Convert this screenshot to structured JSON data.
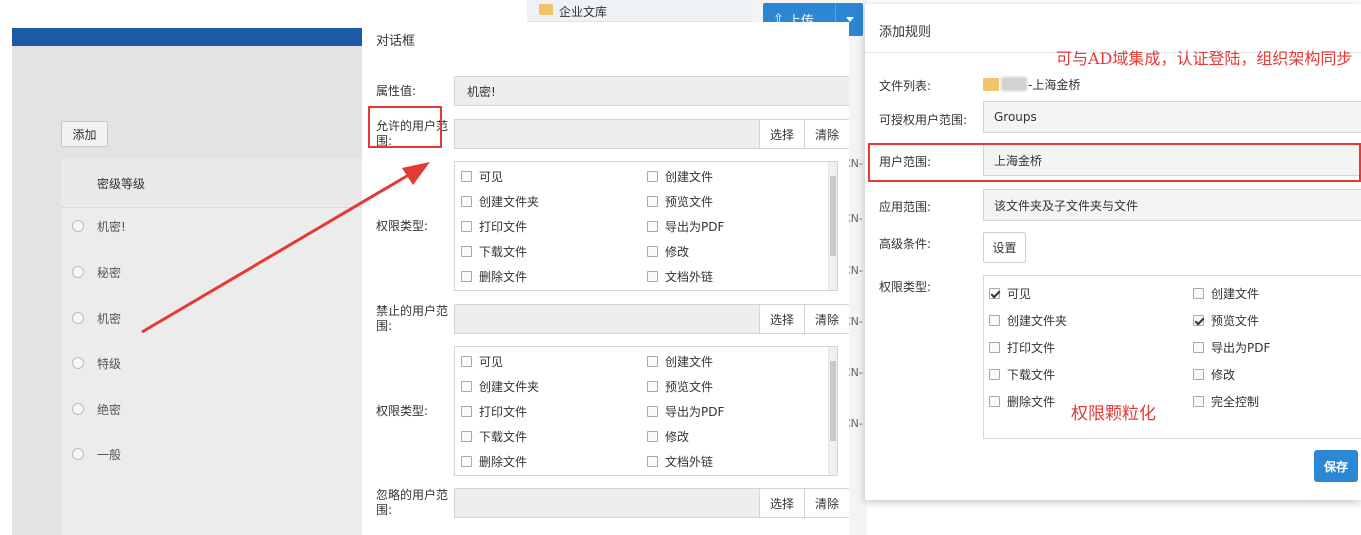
{
  "levels_panel": {
    "add_label": "添加",
    "header": "密级等级",
    "levels": [
      "机密!",
      "秘密",
      "机密",
      "特级",
      "绝密",
      "一般"
    ]
  },
  "peek": {
    "folder_label": "企业文库",
    "upload_label": "上传",
    "row_tags": [
      "CN-",
      "CN-",
      "CN-",
      "CN-",
      "CN-",
      "CN-",
      "CN-"
    ]
  },
  "properties_dialog": {
    "title": "对话框",
    "property_value_label": "属性值:",
    "property_value": "机密!",
    "allowed_scope_label": "允许的用户范围:",
    "forbidden_scope_label": "禁止的用户范围:",
    "ignored_scope_label": "忽略的用户范围:",
    "permission_type_label": "权限类型:",
    "select_label": "选择",
    "clear_label": "清除",
    "permissions_left": [
      "可见",
      "创建文件夹",
      "打印文件",
      "下载文件",
      "删除文件"
    ],
    "permissions_right": [
      "创建文件",
      "预览文件",
      "导出为PDF",
      "修改",
      "文档外链"
    ]
  },
  "rule_dialog": {
    "title": "添加规则",
    "file_list_label": "文件列表:",
    "file_name": "-上海金桥",
    "grantable_scope_label": "可授权用户范围:",
    "grantable_scope_value": "Groups",
    "user_scope_label": "用户范围:",
    "user_scope_value": "上海金桥",
    "apply_scope_label": "应用范围:",
    "apply_scope_value": "该文件夹及子文件夹与文件",
    "advanced_label": "高级条件:",
    "settings_label": "设置",
    "permission_type_label": "权限类型:",
    "permissions_left": [
      {
        "label": "可见",
        "checked": true
      },
      {
        "label": "创建文件夹",
        "checked": false
      },
      {
        "label": "打印文件",
        "checked": false
      },
      {
        "label": "下载文件",
        "checked": false
      },
      {
        "label": "删除文件",
        "checked": false
      }
    ],
    "permissions_right": [
      {
        "label": "创建文件",
        "checked": false
      },
      {
        "label": "预览文件",
        "checked": true
      },
      {
        "label": "导出为PDF",
        "checked": false
      },
      {
        "label": "修改",
        "checked": false
      },
      {
        "label": "完全控制",
        "checked": false
      }
    ],
    "save_label": "保存"
  },
  "annotations": {
    "top_note": "可与AD域集成，认证登陆，组织架构同步",
    "granular_note": "权限颗粒化",
    "color": "#e53935"
  }
}
